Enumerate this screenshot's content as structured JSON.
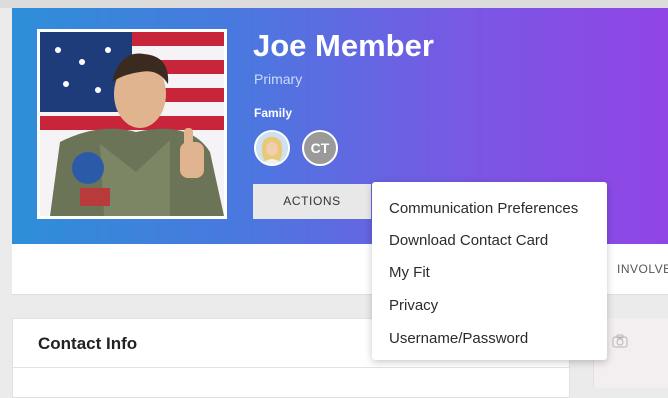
{
  "profile": {
    "name": "Joe Member",
    "role": "Primary",
    "family_label": "Family",
    "family_members": [
      {
        "type": "photo"
      },
      {
        "type": "initials",
        "initials": "CT"
      }
    ]
  },
  "actions": {
    "label": "ACTIONS",
    "menu": [
      "Communication Preferences",
      "Download Contact Card",
      "My Fit",
      "Privacy",
      "Username/Password"
    ]
  },
  "tabs": {
    "visible_tab": "INVOLVEMENT"
  },
  "contact": {
    "title": "Contact Info"
  },
  "colors": {
    "hero_start": "#2e8fd8",
    "hero_end": "#9145e6",
    "button_bg": "#e8e8e8"
  }
}
